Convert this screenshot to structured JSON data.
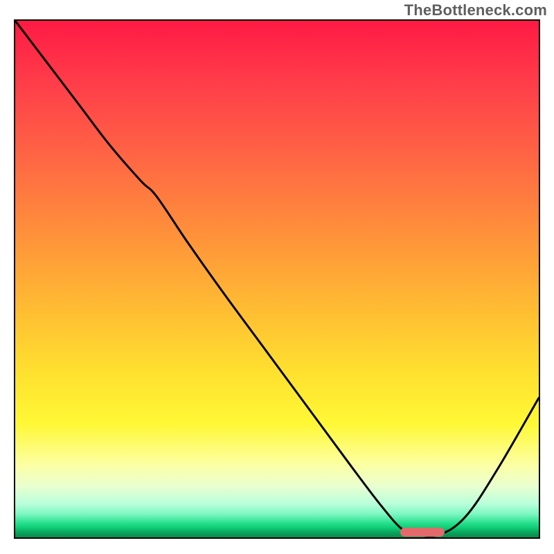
{
  "watermark": "TheBottleneck.com",
  "chart_data": {
    "type": "line",
    "title": "",
    "xlabel": "",
    "ylabel": "",
    "x": [
      0.0,
      0.06,
      0.12,
      0.18,
      0.24,
      0.27,
      0.33,
      0.4,
      0.48,
      0.56,
      0.64,
      0.7,
      0.74,
      0.77,
      0.81,
      0.86,
      0.92,
      1.0
    ],
    "values": [
      1.0,
      0.92,
      0.84,
      0.76,
      0.69,
      0.66,
      0.57,
      0.47,
      0.36,
      0.25,
      0.14,
      0.06,
      0.015,
      0.005,
      0.005,
      0.04,
      0.13,
      0.27
    ],
    "xlim": [
      0,
      1
    ],
    "ylim": [
      0,
      1
    ],
    "marker": {
      "x_start": 0.735,
      "x_end": 0.82,
      "y": 0.005
    }
  },
  "colors": {
    "gradient_top": "#ff1a44",
    "gradient_mid": "#ffe02f",
    "gradient_bottom": "#088a4e",
    "curve": "#000000",
    "marker": "#e26a6a",
    "watermark": "#5f5f5f"
  }
}
